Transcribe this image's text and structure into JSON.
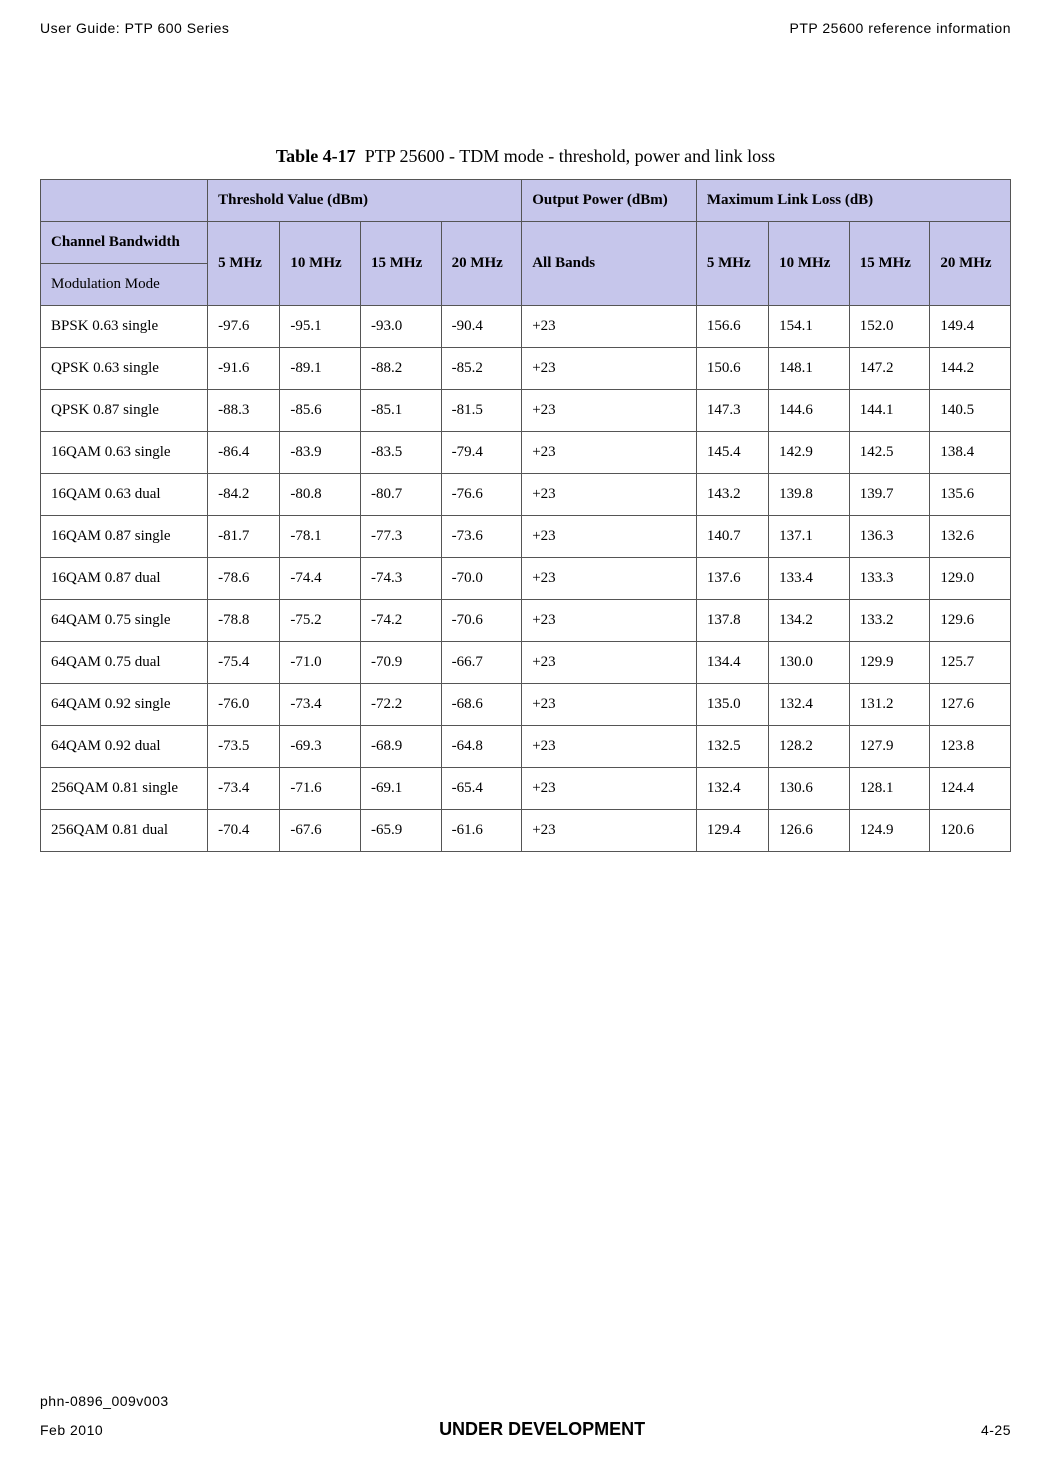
{
  "header": {
    "left": "User Guide: PTP 600 Series",
    "right": "PTP 25600 reference information"
  },
  "caption": {
    "label": "Table 4-17",
    "text": "PTP 25600 - TDM mode - threshold, power and link loss"
  },
  "table_headers": {
    "threshold": "Threshold Value (dBm)",
    "output": "Output Power (dBm)",
    "maxlink": "Maximum Link Loss (dB)",
    "channel": "Channel Bandwidth",
    "modulation": "Modulation Mode",
    "mhz5": "5 MHz",
    "mhz10": "10 MHz",
    "mhz15": "15 MHz",
    "mhz20": "20 MHz",
    "allbands": "All Bands"
  },
  "chart_data": {
    "type": "table",
    "columns": [
      "Modulation Mode",
      "5 MHz (Threshold)",
      "10 MHz (Threshold)",
      "15 MHz (Threshold)",
      "20 MHz (Threshold)",
      "All Bands (Output Power)",
      "5 MHz (Link Loss)",
      "10 MHz (Link Loss)",
      "15 MHz (Link Loss)",
      "20 MHz (Link Loss)"
    ],
    "rows": [
      {
        "mode": "BPSK 0.63 single",
        "t5": "-97.6",
        "t10": "-95.1",
        "t15": "-93.0",
        "t20": "-90.4",
        "pwr": "+23",
        "l5": "156.6",
        "l10": "154.1",
        "l15": "152.0",
        "l20": "149.4"
      },
      {
        "mode": "QPSK 0.63 single",
        "t5": "-91.6",
        "t10": "-89.1",
        "t15": "-88.2",
        "t20": "-85.2",
        "pwr": "+23",
        "l5": "150.6",
        "l10": "148.1",
        "l15": "147.2",
        "l20": "144.2"
      },
      {
        "mode": "QPSK 0.87 single",
        "t5": "-88.3",
        "t10": "-85.6",
        "t15": "-85.1",
        "t20": "-81.5",
        "pwr": "+23",
        "l5": "147.3",
        "l10": "144.6",
        "l15": "144.1",
        "l20": "140.5"
      },
      {
        "mode": "16QAM 0.63 single",
        "t5": "-86.4",
        "t10": "-83.9",
        "t15": "-83.5",
        "t20": "-79.4",
        "pwr": "+23",
        "l5": "145.4",
        "l10": "142.9",
        "l15": "142.5",
        "l20": "138.4"
      },
      {
        "mode": "16QAM 0.63 dual",
        "t5": "-84.2",
        "t10": "-80.8",
        "t15": "-80.7",
        "t20": "-76.6",
        "pwr": "+23",
        "l5": "143.2",
        "l10": "139.8",
        "l15": "139.7",
        "l20": "135.6"
      },
      {
        "mode": "16QAM 0.87 single",
        "t5": "-81.7",
        "t10": "-78.1",
        "t15": "-77.3",
        "t20": "-73.6",
        "pwr": "+23",
        "l5": "140.7",
        "l10": "137.1",
        "l15": "136.3",
        "l20": "132.6"
      },
      {
        "mode": "16QAM 0.87 dual",
        "t5": "-78.6",
        "t10": "-74.4",
        "t15": "-74.3",
        "t20": "-70.0",
        "pwr": "+23",
        "l5": "137.6",
        "l10": "133.4",
        "l15": "133.3",
        "l20": "129.0"
      },
      {
        "mode": "64QAM 0.75 single",
        "t5": "-78.8",
        "t10": "-75.2",
        "t15": "-74.2",
        "t20": "-70.6",
        "pwr": "+23",
        "l5": "137.8",
        "l10": "134.2",
        "l15": "133.2",
        "l20": "129.6"
      },
      {
        "mode": "64QAM 0.75 dual",
        "t5": "-75.4",
        "t10": "-71.0",
        "t15": "-70.9",
        "t20": "-66.7",
        "pwr": "+23",
        "l5": "134.4",
        "l10": "130.0",
        "l15": "129.9",
        "l20": "125.7"
      },
      {
        "mode": "64QAM 0.92 single",
        "t5": "-76.0",
        "t10": "-73.4",
        "t15": "-72.2",
        "t20": "-68.6",
        "pwr": "+23",
        "l5": "135.0",
        "l10": "132.4",
        "l15": "131.2",
        "l20": "127.6"
      },
      {
        "mode": "64QAM 0.92 dual",
        "t5": "-73.5",
        "t10": "-69.3",
        "t15": "-68.9",
        "t20": "-64.8",
        "pwr": "+23",
        "l5": "132.5",
        "l10": "128.2",
        "l15": "127.9",
        "l20": "123.8"
      },
      {
        "mode": "256QAM 0.81 single",
        "t5": "-73.4",
        "t10": "-71.6",
        "t15": "-69.1",
        "t20": "-65.4",
        "pwr": "+23",
        "l5": "132.4",
        "l10": "130.6",
        "l15": "128.1",
        "l20": "124.4"
      },
      {
        "mode": "256QAM 0.81 dual",
        "t5": "-70.4",
        "t10": "-67.6",
        "t15": "-65.9",
        "t20": "-61.6",
        "pwr": "+23",
        "l5": "129.4",
        "l10": "126.6",
        "l15": "124.9",
        "l20": "120.6"
      }
    ]
  },
  "footer": {
    "docid": "phn-0896_009v003",
    "date": "Feb 2010",
    "status": "UNDER DEVELOPMENT",
    "page": "4-25"
  }
}
